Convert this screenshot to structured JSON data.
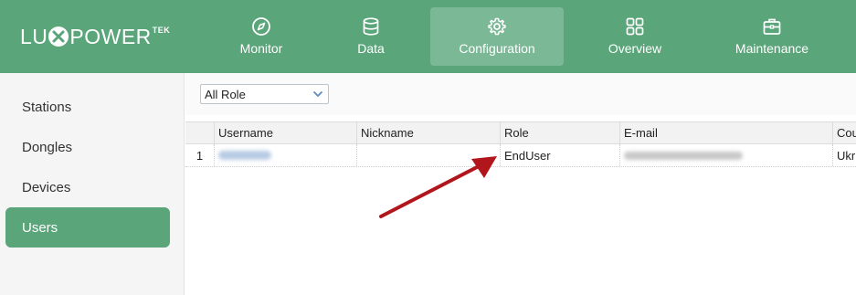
{
  "app": {
    "logo_text_left": "LU",
    "logo_text_right": "POWER",
    "logo_superscript": "TEK"
  },
  "nav": {
    "items": [
      {
        "label": "Monitor",
        "icon": "compass-icon"
      },
      {
        "label": "Data",
        "icon": "database-icon"
      },
      {
        "label": "Configuration",
        "icon": "gear-icon",
        "active": true
      },
      {
        "label": "Overview",
        "icon": "grid-icon"
      },
      {
        "label": "Maintenance",
        "icon": "toolbox-icon"
      }
    ]
  },
  "sidebar": {
    "items": [
      {
        "label": "Stations"
      },
      {
        "label": "Dongles"
      },
      {
        "label": "Devices"
      },
      {
        "label": "Users",
        "active": true
      }
    ]
  },
  "filter": {
    "role_selected": "All Role"
  },
  "table": {
    "columns": [
      "",
      "Username",
      "Nickname",
      "Role",
      "E-mail",
      "Cou"
    ],
    "rows": [
      {
        "index": "1",
        "username": "",
        "nickname": "",
        "role": "EndUser",
        "email": "",
        "country": "Ukr"
      }
    ]
  },
  "colors": {
    "brand_green": "#5aa57a",
    "active_nav_bg": "#7bb896",
    "annotation_arrow": "#b0161c"
  }
}
